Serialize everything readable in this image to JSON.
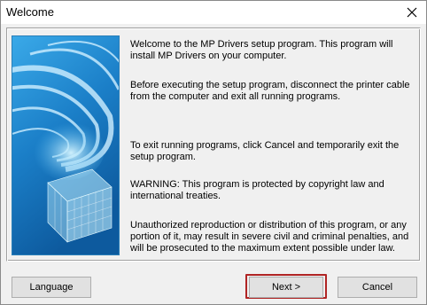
{
  "window": {
    "title": "Welcome",
    "close_icon": "close-icon"
  },
  "content": {
    "paragraphs": [
      "Welcome to the MP Drivers setup program. This program will install MP Drivers on your computer.",
      "Before executing the setup program, disconnect the printer cable from the computer and exit all running programs.",
      "To exit running programs, click Cancel and temporarily exit the setup program.",
      "WARNING: This program is protected by copyright law and international treaties.",
      "Unauthorized reproduction or distribution of this program, or any portion of it, may result in severe civil and criminal penalties, and will be prosecuted to the maximum extent possible under law."
    ],
    "artwork_icon": "setup-swirl-artwork"
  },
  "buttons": {
    "language": "Language",
    "next": "Next >",
    "cancel": "Cancel"
  },
  "colors": {
    "highlight": "#b02424",
    "artwork_primary": "#1f8fd6",
    "artwork_accent": "#a8e6ff"
  }
}
